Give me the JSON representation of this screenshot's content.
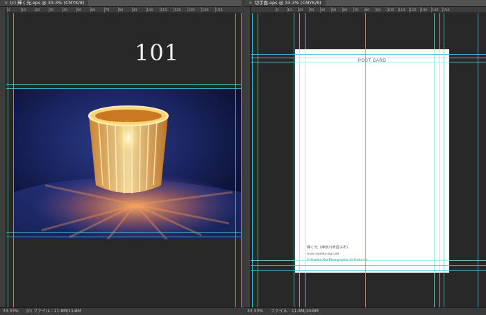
{
  "left_document": {
    "tab_close": "×",
    "tab_label": "(c) 輝く光.eps @ 33.3% (CMYK/8)",
    "ruler_ticks": [
      "0",
      "10",
      "20",
      "30",
      "40",
      "50",
      "60",
      "70",
      "80",
      "90",
      "100",
      "110",
      "120",
      "130",
      "140",
      "150"
    ],
    "page_number": "101",
    "status_zoom": "33.33%",
    "status_info": "(c) ファイル : 11.8M/11.8M",
    "status_arrow": "›"
  },
  "right_document": {
    "tab_close": "×",
    "tab_label": "切手面.eps @ 33.3% (CMYK/8)",
    "ruler_ticks": [
      "0",
      "10",
      "20",
      "30",
      "40",
      "50",
      "60",
      "70",
      "80",
      "90",
      "100",
      "110",
      "120",
      "130",
      "140",
      "150"
    ],
    "card_title": "POST CARD",
    "card_caption": "輝く光（神奈川県逗子市）",
    "card_url": "www.yumiko-ota.com",
    "card_copyright": "© Yumiko Ota Photographer, in Zushi city",
    "status_zoom": "33.33%",
    "status_info": "ファイル : 11.8M/10.8M",
    "status_arrow": "›"
  },
  "colors": {
    "guide": "#3fc4d6",
    "canvas_bg": "#282828",
    "card_bg": "#ffffff"
  }
}
